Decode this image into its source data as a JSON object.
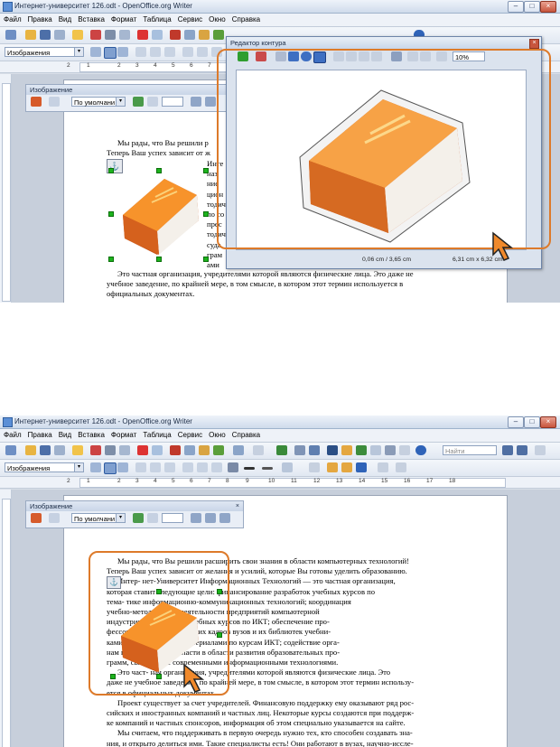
{
  "window": {
    "title": "Интернет-университет 126.odt - OpenOffice.org Writer",
    "min_glyph": "–",
    "max_glyph": "□",
    "close_glyph": "×"
  },
  "menu": [
    "Файл",
    "Правка",
    "Вид",
    "Вставка",
    "Формат",
    "Таблица",
    "Сервис",
    "Окно",
    "Справка"
  ],
  "formatting": {
    "style_value": "Изображения",
    "dropdown_glyph": "▾"
  },
  "standard_toolbar": {
    "find_placeholder": "Найти"
  },
  "ruler": {
    "ticks": [
      "2",
      "1",
      "1",
      "2",
      "3",
      "4",
      "5",
      "6",
      "7",
      "8",
      "9",
      "10",
      "11",
      "12",
      "13",
      "14",
      "15",
      "16",
      "17",
      "18"
    ]
  },
  "image_toolbar": {
    "title": "Изображение",
    "filter_value": "По умолчани",
    "spin_value": ""
  },
  "contour_editor": {
    "title": "Редактор контура",
    "zoom_value": "10%",
    "status_position": "0,06 cm / 3,65 cm",
    "status_size": "6,31 cm x 6,32 cm"
  },
  "doc_top": {
    "lines": [
      "Мы рады, что Вы решили р",
      "Теперь Ваш успех зависит от ж",
      "Инте",
      "наз",
      "ние",
      "цион",
      "тодич",
      "по со",
      "прес",
      "тодич",
      "суда",
      "грам",
      "ами",
      "Это частная организация, учредителями которой являются физические лица. Это даже не",
      "учебное заведение, по крайней мере, в том смысле, в котором этот термин используется в",
      "официальных документах."
    ]
  },
  "doc_bottom": {
    "lines": [
      "Мы рады, что Вы решили расширить свои знания в области компьютерных технологий!",
      "Теперь Ваш успех зависит от желания и усилий, которые Вы готовы уделить образованию.",
      "Интер-        нет-Университет Информационных Технологий — это частная организация,",
      "которая              ставит следующие цели: финансирование разработок учебных курсов по",
      "тема-                   тике информационно-коммуникационных технологий; координация",
      "                            учебно-методической деятельности предприятий компьютерной",
      "                            индустрии по созданию учебных курсов по ИКТ; обеспечение про-",
      "                          фессорско-преподавательских кадров вузов и их библиотек учебни-",
      "                          ками и методическими материалами по курсам ИКТ; содействие орга-",
      "                       нам государственной власти в области развития образовательных про-",
      "грамм,               связанных с современными информационными технологиями.",
      "Это част-      ная организация, учредителями которой являются физические лица. Это",
      "даже не учебное заведение, по крайней мере, в том смысле, в котором этот термин использу-",
      "ется в официальных документах.",
      "Проект существует за счет учредителей. Финансовую поддержку ему оказывают ряд рос-",
      "сийских и иностранных компаний и частных лиц. Некоторые курсы создаются при поддерж-",
      "ке компаний и частных спонсоров, информация об этом специально указывается на сайте.",
      "Мы считаем, что поддерживать в первую очередь нужно тех, кто способен создавать зна-",
      "ния, и открыто делиться ими. Такие специалисты есть! Они работают в вузах, научно-иссле-"
    ]
  },
  "colors": {
    "accent_orange": "#dd7a2a",
    "book_orange": "#f08a1e",
    "handle_green": "#1db31d"
  }
}
